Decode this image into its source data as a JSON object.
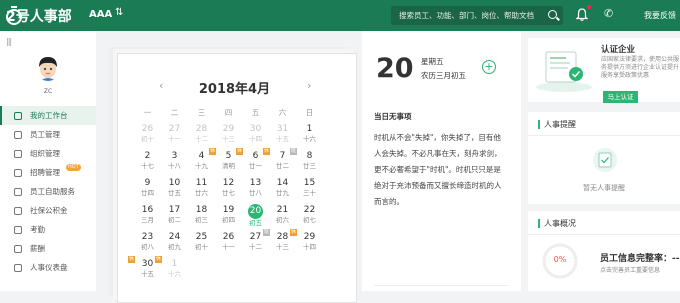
{
  "topbar": {
    "logo_text": "2号人事部",
    "company": "AAA",
    "search_placeholder": "搜索员工、功能、部门、岗位、帮助文档",
    "feedback": "我要反馈"
  },
  "sidebar": {
    "collapse_glyph": "|||",
    "user_name": "ZC",
    "hot_badge": "HOT",
    "items": [
      {
        "label": "我的工作台",
        "active": true
      },
      {
        "label": "员工管理"
      },
      {
        "label": "组织管理"
      },
      {
        "label": "招聘管理"
      },
      {
        "label": "员工自助服务"
      },
      {
        "label": "社保公积金"
      },
      {
        "label": "考勤"
      },
      {
        "label": "薪酬"
      },
      {
        "label": "人事仪表盘"
      }
    ]
  },
  "calendar": {
    "title": "2018年4月",
    "prev": "‹",
    "next": "›",
    "weekdays": [
      "一",
      "二",
      "三",
      "四",
      "五",
      "六",
      "日"
    ],
    "tag_marks": {
      "o": "休",
      "g": "班"
    },
    "days": [
      {
        "d": "26",
        "l": "初十",
        "dim": true
      },
      {
        "d": "27",
        "l": "十一",
        "dim": true
      },
      {
        "d": "28",
        "l": "十二",
        "dim": true
      },
      {
        "d": "29",
        "l": "十三",
        "dim": true
      },
      {
        "d": "30",
        "l": "十四",
        "dim": true
      },
      {
        "d": "31",
        "l": "十五",
        "dim": true
      },
      {
        "d": "1",
        "l": "十六"
      },
      {
        "d": "2",
        "l": "十七"
      },
      {
        "d": "3",
        "l": "十八"
      },
      {
        "d": "4",
        "l": "十九"
      },
      {
        "d": "5",
        "l": "清明",
        "tag": "o"
      },
      {
        "d": "6",
        "l": "廿一",
        "tag": "o"
      },
      {
        "d": "7",
        "l": "廿二",
        "tag": "o"
      },
      {
        "d": "8",
        "l": "廿三",
        "tag": "g"
      },
      {
        "d": "9",
        "l": "廿四"
      },
      {
        "d": "10",
        "l": "廿五"
      },
      {
        "d": "11",
        "l": "廿六"
      },
      {
        "d": "12",
        "l": "廿七"
      },
      {
        "d": "13",
        "l": "廿八"
      },
      {
        "d": "14",
        "l": "廿九"
      },
      {
        "d": "15",
        "l": "三十"
      },
      {
        "d": "16",
        "l": "三月"
      },
      {
        "d": "17",
        "l": "初二"
      },
      {
        "d": "18",
        "l": "初三"
      },
      {
        "d": "19",
        "l": "初四"
      },
      {
        "d": "20",
        "l": "初五",
        "today": true
      },
      {
        "d": "21",
        "l": "初六"
      },
      {
        "d": "22",
        "l": "初七"
      },
      {
        "d": "23",
        "l": "初八"
      },
      {
        "d": "24",
        "l": "初九"
      },
      {
        "d": "25",
        "l": "初十"
      },
      {
        "d": "26",
        "l": "十一"
      },
      {
        "d": "27",
        "l": "十二"
      },
      {
        "d": "28",
        "l": "十三",
        "tag": "g"
      },
      {
        "d": "29",
        "l": "十四",
        "tag": "o"
      },
      {
        "d": "30",
        "l": "十五",
        "tag": "o"
      },
      {
        "d": "1",
        "l": "十六",
        "dim": true,
        "tag": "o"
      },
      {
        "d": "",
        "l": ""
      },
      {
        "d": "",
        "l": ""
      },
      {
        "d": "",
        "l": ""
      },
      {
        "d": "",
        "l": ""
      },
      {
        "d": "",
        "l": ""
      }
    ]
  },
  "day_panel": {
    "day": "20",
    "weekday": "星期五",
    "lunar": "农历三月初五",
    "add": "+",
    "no_event": "当日无事项",
    "quote": "时机从不会\"失掉\"，你失掉了，目有他人会失掉。不必凡事在天，刻舟求剑，更不必奢希望于\"时机\"。时机只只是是绝对于充沛预备而又擅长缔造时机的人而言的。"
  },
  "promo": {
    "title": "认证企业",
    "text": "应国家法律要求，使用公共服务提供方须进行企业认证提升服务享受政策优惠",
    "button": "马上认证"
  },
  "remind": {
    "title": "人事提醒",
    "empty": "暂无人事提醒"
  },
  "overview": {
    "title": "人事概况",
    "percent": "0%",
    "label": "员工信息完整率：--",
    "sub": "点击完善员工重要信息"
  },
  "colors": {
    "brand": "#1a7b55",
    "accent": "#2bb673",
    "holiday": "#f0a030"
  }
}
